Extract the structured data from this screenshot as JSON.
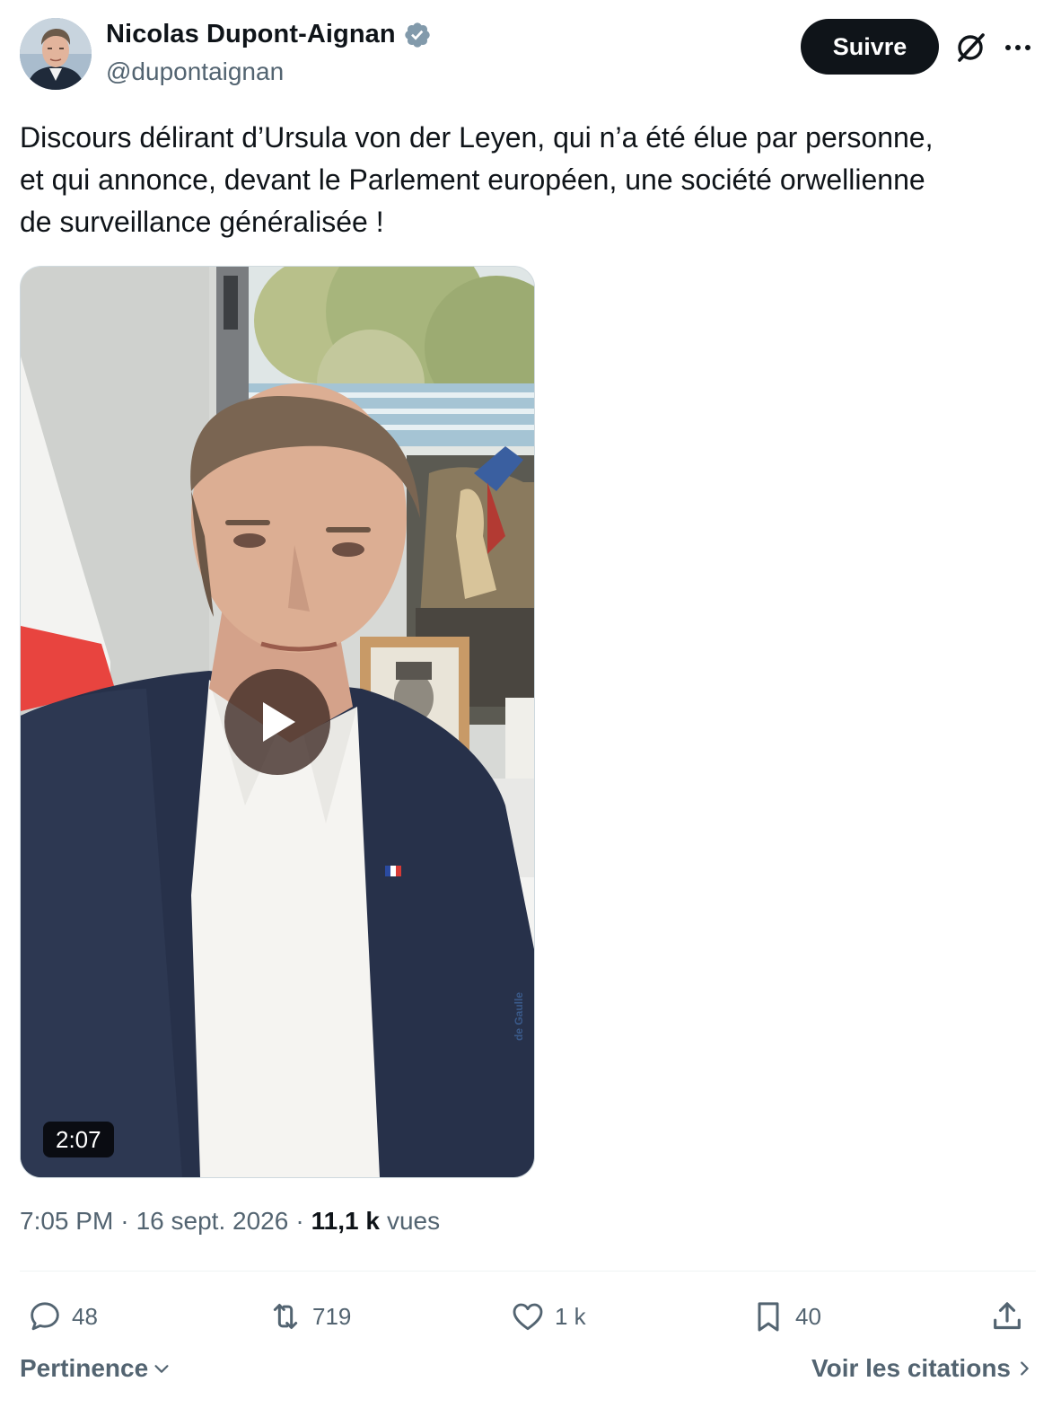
{
  "author": {
    "display_name": "Nicolas Dupont-Aignan",
    "handle": "@dupontaignan",
    "verified": true,
    "badge_color": "#829aab"
  },
  "header": {
    "follow_label": "Suivre",
    "grok_icon": "grok-icon",
    "more_icon": "more-icon"
  },
  "tweet": {
    "text": "Discours délirant d’Ursula von der Leyen, qui n’a été élue par personne,\net qui annonce, devant le Parlement européen, une société orwellienne\nde surveillance généralisée !"
  },
  "media": {
    "type": "video",
    "duration": "2:07",
    "book_spine_text": "de Gaulle"
  },
  "meta": {
    "time": "7:05 PM",
    "date": "16 sept. 2026",
    "views_count": "11,1 k",
    "views_label": "vues"
  },
  "actions": {
    "replies": "48",
    "reposts": "719",
    "likes": "1 k",
    "bookmarks": "40"
  },
  "footer": {
    "sort_label": "Pertinence",
    "quotes_label": "Voir les citations"
  },
  "colors": {
    "text_primary": "#0f1419",
    "text_secondary": "#536471",
    "button_dark": "#0f1419"
  }
}
